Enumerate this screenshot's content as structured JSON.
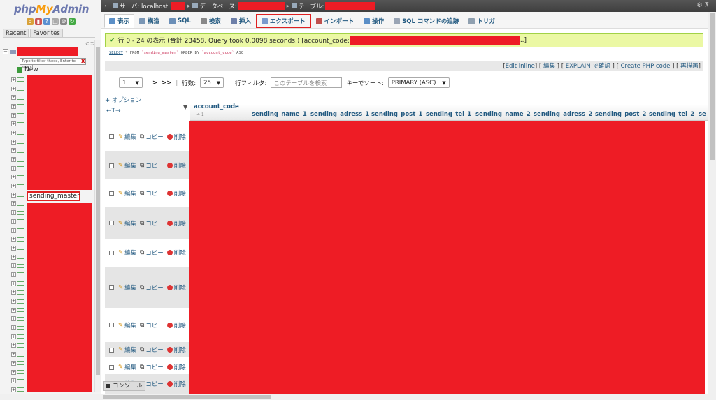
{
  "nav": {
    "logo_php": "php",
    "logo_my": "My",
    "logo_admin": "Admin",
    "tab_recent": "Recent",
    "tab_favorites": "Favorites",
    "filter_placeholder": "Type to filter these, Enter to search",
    "filter_clear": "X",
    "new_label": "New",
    "selected_table": "sending_master"
  },
  "breadcrumb": {
    "server_label": "サーバ: localhost:",
    "database_label": "データベース:",
    "table_label": "テーブル:"
  },
  "tabs": [
    {
      "label": "表示",
      "color": "#5b8fc7"
    },
    {
      "label": "構造",
      "color": "#7a96b5"
    },
    {
      "label": "SQL",
      "color": "#6b8fb8"
    },
    {
      "label": "検索",
      "color": "#888888"
    },
    {
      "label": "挿入",
      "color": "#6d7fa8"
    },
    {
      "label": "エクスポート",
      "color": "#7a9acd"
    },
    {
      "label": "インポート",
      "color": "#c0504d"
    },
    {
      "label": "操作",
      "color": "#5b8fc7"
    },
    {
      "label": "SQL コマンドの追跡",
      "color": "#9aa5b5"
    },
    {
      "label": "トリガ",
      "color": "#8fa0b0"
    }
  ],
  "message": {
    "text": "行 0 - 24 の表示 (合計 23458, Query took 0.0098 seconds.) [account_code:",
    "close": "..]"
  },
  "sql": {
    "select": "SELECT",
    "star": "* FROM",
    "table": "`sending_master`",
    "order": "ORDER BY",
    "col": "`account_code`",
    "dir": "ASC"
  },
  "query_links": {
    "edit_inline": "Edit inline",
    "edit": "編集",
    "explain": "EXPLAIN で確認",
    "php": "Create PHP code",
    "refresh": "再描画"
  },
  "pager": {
    "page": "1",
    "next": ">",
    "last": ">>",
    "rows_label": "行数:",
    "rows_value": "25",
    "filter_label": "行フィルタ:",
    "filter_placeholder": "このテーブルを検索",
    "sort_label": "キーでソート:",
    "sort_value": "PRIMARY (ASC)"
  },
  "options_label": "+ オプション",
  "table": {
    "lr_arrows": "←T→",
    "sort_arrow": "▼",
    "first_col": "account_code",
    "first_col_sub": "≐ 1",
    "columns": [
      "sending_name_1",
      "sending_adress_1",
      "sending_post_1",
      "sending_tel_1",
      "sending_name_2",
      "sending_adress_2",
      "sending_post_2",
      "sending_tel_2",
      "se"
    ],
    "actions": {
      "edit": "編集",
      "copy": "コピー",
      "delete": "削除"
    }
  },
  "console_label": "コンソール"
}
